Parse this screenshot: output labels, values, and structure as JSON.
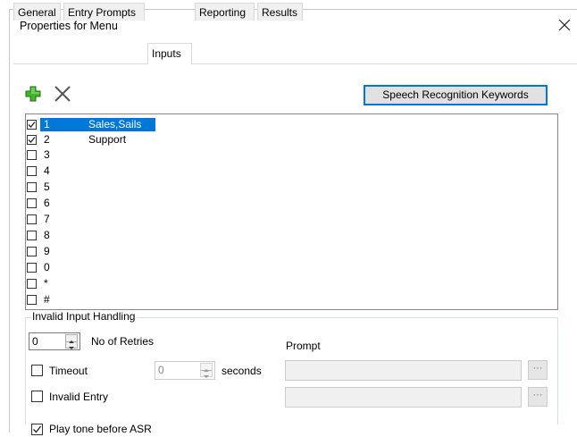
{
  "window": {
    "title": "Properties for Menu"
  },
  "tabs": [
    {
      "label": "General"
    },
    {
      "label": "Entry Prompts"
    },
    {
      "label": "Inputs"
    },
    {
      "label": "Reporting"
    },
    {
      "label": "Results"
    }
  ],
  "active_tab": "Inputs",
  "toolbar": {
    "add_icon": "plus-icon",
    "delete_icon": "x-icon",
    "asr_button_label": "Speech Recognition Keywords"
  },
  "inputs": [
    {
      "key": "1",
      "desc": "Sales,Sails",
      "checked": true,
      "selected": true
    },
    {
      "key": "2",
      "desc": "Support",
      "checked": true,
      "selected": false
    },
    {
      "key": "3",
      "desc": "",
      "checked": false,
      "selected": false
    },
    {
      "key": "4",
      "desc": "",
      "checked": false,
      "selected": false
    },
    {
      "key": "5",
      "desc": "",
      "checked": false,
      "selected": false
    },
    {
      "key": "6",
      "desc": "",
      "checked": false,
      "selected": false
    },
    {
      "key": "7",
      "desc": "",
      "checked": false,
      "selected": false
    },
    {
      "key": "8",
      "desc": "",
      "checked": false,
      "selected": false
    },
    {
      "key": "9",
      "desc": "",
      "checked": false,
      "selected": false
    },
    {
      "key": "0",
      "desc": "",
      "checked": false,
      "selected": false
    },
    {
      "key": "*",
      "desc": "",
      "checked": false,
      "selected": false
    },
    {
      "key": "#",
      "desc": "",
      "checked": false,
      "selected": false
    }
  ],
  "invalid_handling": {
    "legend": "Invalid Input Handling",
    "retries_value": "0",
    "retries_label": "No of Retries",
    "prompt_label": "Prompt",
    "timeout_label": "Timeout",
    "timeout_value": "0",
    "seconds_label": "seconds",
    "invalid_entry_label": "Invalid Entry",
    "ellipsis": "···"
  },
  "play_tone": {
    "label": "Play tone before ASR",
    "checked": true
  },
  "colors": {
    "selection": "#0078d7",
    "add_icon": "#2e9e1e"
  }
}
